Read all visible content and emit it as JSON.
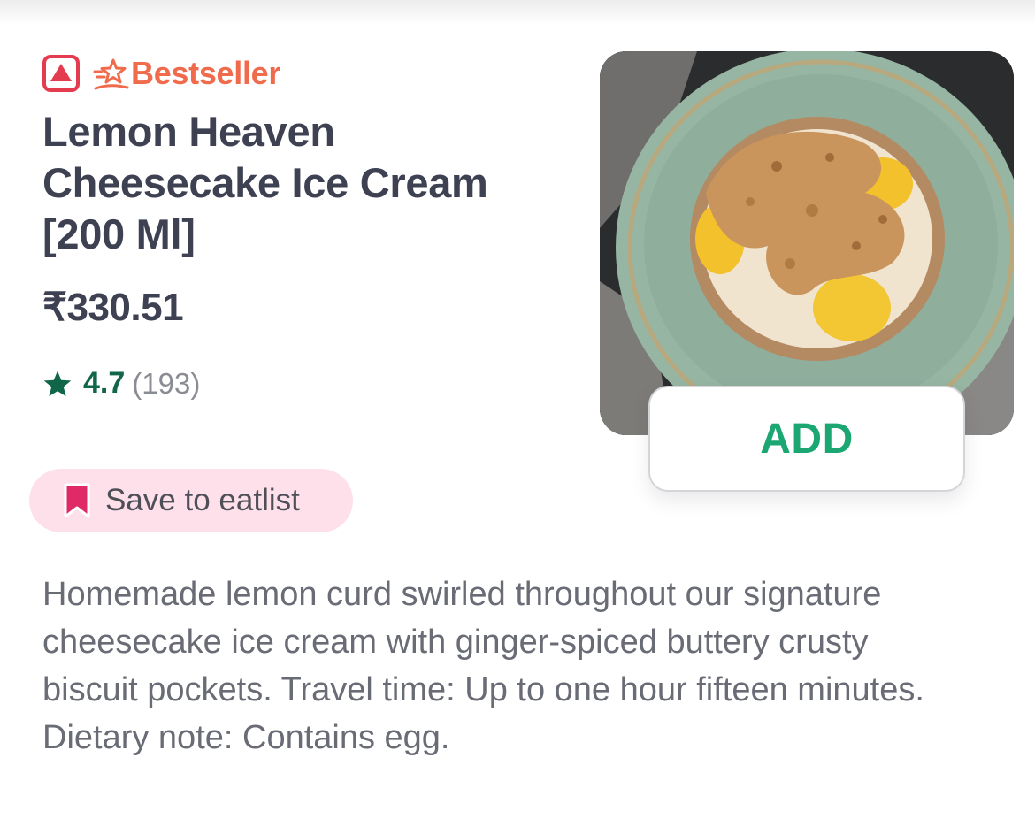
{
  "item": {
    "badge": "Bestseller",
    "title": "Lemon Heaven Cheesecake Ice Cream [200 Ml]",
    "price": "₹330.51",
    "rating": "4.7",
    "rating_count": "(193)",
    "save_label": "Save to eatlist",
    "add_label": "ADD",
    "description": "Homemade lemon curd swirled throughout our signature cheesecake ice cream with ginger-spiced buttery crusty biscuit pockets. Travel time: Up to one hour fifteen minutes. Dietary note: Contains egg."
  },
  "icons": {
    "diet": "non-veg-icon",
    "badge": "bestseller-star-icon",
    "rating": "star-icon",
    "save": "bookmark-icon"
  },
  "colors": {
    "nonveg": "#e43b4f",
    "bestseller": "#f06b4c",
    "rating": "#116649",
    "add": "#1ba672",
    "save_bg": "#fde0ea",
    "save_icon": "#e02a67",
    "text": "#3d4152",
    "description": "#696c75"
  }
}
